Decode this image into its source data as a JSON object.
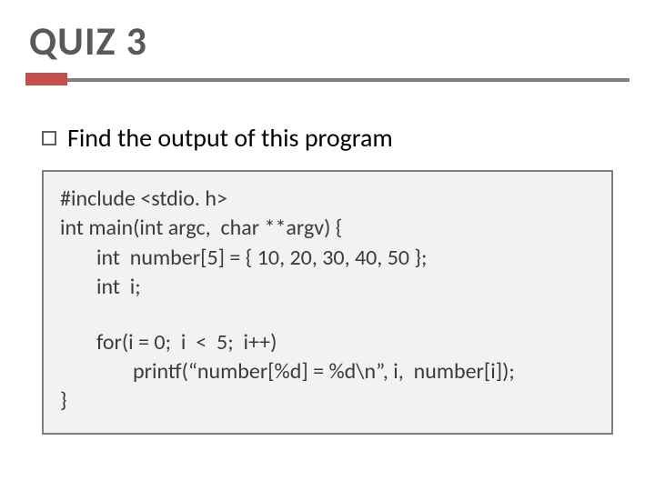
{
  "title": "QUIZ 3",
  "bullet": "Find the output of this program",
  "code": {
    "l1": "#include <stdio. h>",
    "l2": "int main(int argc,  char **argv) {",
    "l3": "int  number[5] = { 10, 20, 30, 40, 50 };",
    "l4": "int  i;",
    "l5": "for(i = 0;  i  <  5;  i++)",
    "l6": "printf(“number[%d] = %d\\n”, i,  number[i]);",
    "l7": "}"
  }
}
